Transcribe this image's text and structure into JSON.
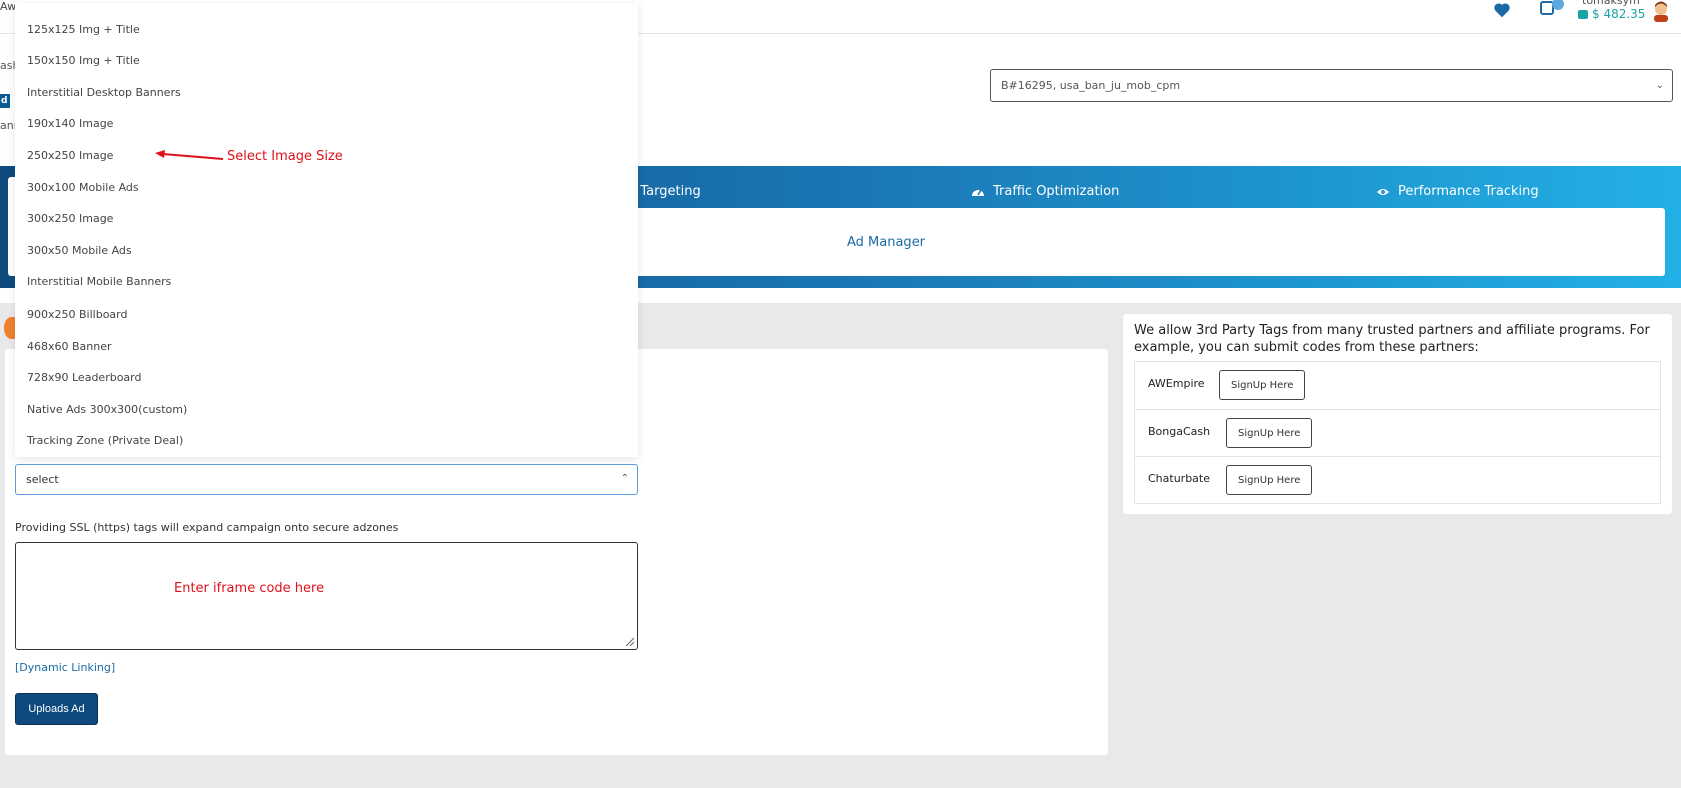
{
  "header": {
    "clipped_title": "Awe",
    "user_name": "tomaksym",
    "balance": "$ 482.35"
  },
  "left_clipped": {
    "label_1": "ash",
    "badge": "d",
    "label_2": "ann"
  },
  "campaign_select": {
    "value": "B#16295, usa_ban_ju_mob_cpm"
  },
  "nav_tabs": [
    {
      "label": "d Targeting"
    },
    {
      "label": "Traffic Optimization"
    },
    {
      "label": "Performance Tracking"
    }
  ],
  "ad_manager_link": "Ad Manager",
  "dropdown_options": [
    "125x125 Img + Title",
    "150x150 Img + Title",
    "Interstitial Desktop Banners",
    "190x140 Image",
    "250x250 Image",
    "300x100 Mobile Ads",
    "300x250 Image",
    "300x50 Mobile Ads",
    "Interstitial Mobile Banners",
    "900x250 Billboard",
    "468x60 Banner",
    "728x90 Leaderboard",
    "Native Ads 300x300(custom)",
    "Tracking Zone (Private Deal)"
  ],
  "size_select": {
    "value": "select"
  },
  "ssl_label": "Providing SSL (https) tags will expand campaign onto secure adzones",
  "dynamic_link": "[Dynamic Linking]",
  "upload_button": "Uploads Ad",
  "annotations": {
    "select_image_size": "Select Image Size",
    "enter_iframe": "Enter iframe code here"
  },
  "partners": {
    "intro": "We allow 3rd Party Tags from many trusted partners and affiliate programs. For example, you can submit codes from these partners:",
    "rows": [
      {
        "name": "AWEmpire",
        "button": "SignUp Here"
      },
      {
        "name": "BongaCash",
        "button": "SignUp Here"
      },
      {
        "name": "Chaturbate",
        "button": "SignUp Here"
      }
    ]
  },
  "colors": {
    "brand_dark": "#0e4a7e",
    "brand_light": "#22b0e6",
    "annotation_red": "#e0101a",
    "balance_teal": "#1aa3a3"
  }
}
